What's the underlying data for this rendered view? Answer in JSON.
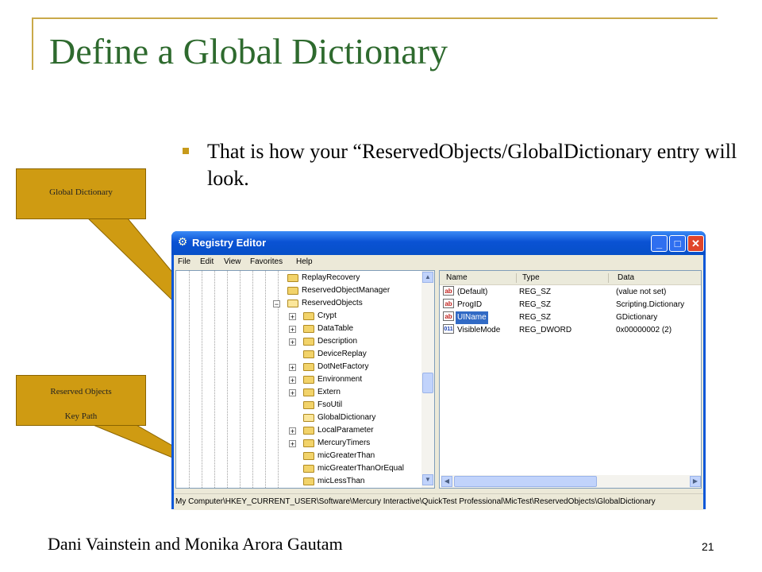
{
  "slide": {
    "title": "Define a Global Dictionary",
    "bullet": "That is how your “ReservedObjects/GlobalDictionary entry will look.",
    "footer": "Dani Vainstein and Monika Arora Gautam",
    "page_number": "21"
  },
  "callouts": {
    "global_dictionary": "Global Dictionary",
    "reserved_objects_line1": "Reserved Objects",
    "reserved_objects_line2": "Key Path"
  },
  "window": {
    "title": "Registry Editor",
    "menu": [
      "File",
      "Edit",
      "View",
      "Favorites",
      "Help"
    ]
  },
  "tree": {
    "items": [
      {
        "label": "ReplayRecovery"
      },
      {
        "label": "ReservedObjectManager"
      },
      {
        "label": "ReservedObjects"
      },
      {
        "label": "Crypt"
      },
      {
        "label": "DataTable"
      },
      {
        "label": "Description"
      },
      {
        "label": "DeviceReplay"
      },
      {
        "label": "DotNetFactory"
      },
      {
        "label": "Environment"
      },
      {
        "label": "Extern"
      },
      {
        "label": "FsoUtil"
      },
      {
        "label": "GlobalDictionary"
      },
      {
        "label": "LocalParameter"
      },
      {
        "label": "MercuryTimers"
      },
      {
        "label": "micGreaterThan"
      },
      {
        "label": "micGreaterThanOrEqual"
      },
      {
        "label": "micLessThan"
      }
    ]
  },
  "list": {
    "headers": [
      "Name",
      "Type",
      "Data"
    ],
    "rows": [
      {
        "icon": "ab",
        "name": "(Default)",
        "type": "REG_SZ",
        "data": "(value not set)"
      },
      {
        "icon": "ab",
        "name": "ProgID",
        "type": "REG_SZ",
        "data": "Scripting.Dictionary"
      },
      {
        "icon": "ab",
        "name": "UIName",
        "type": "REG_SZ",
        "data": "GDictionary"
      },
      {
        "icon": "011",
        "name": "VisibleMode",
        "type": "REG_DWORD",
        "data": "0x00000002 (2)"
      }
    ]
  },
  "statusbar": {
    "path": "My Computer\\HKEY_CURRENT_USER\\Software\\Mercury Interactive\\QuickTest Professional\\MicTest\\ReservedObjects\\GlobalDictionary"
  },
  "colors": {
    "title": "#2e6a2e",
    "accent": "#c9a94a",
    "callout": "#cf9b12",
    "selection": "#316ac5"
  }
}
